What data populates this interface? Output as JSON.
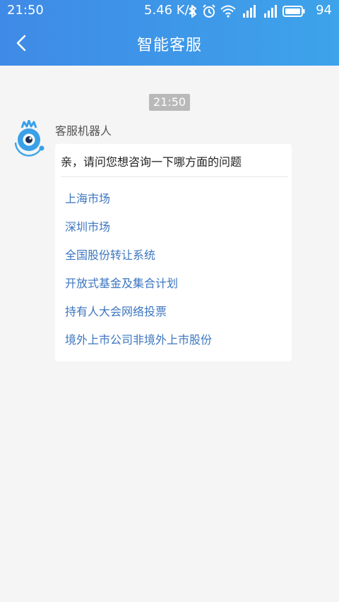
{
  "status_bar": {
    "time": "21:50",
    "network_speed": "5.46 K/s",
    "battery": "94"
  },
  "header": {
    "title": "智能客服"
  },
  "chat": {
    "timestamp": "21:50",
    "sender": "客服机器人",
    "question": "亲，请问您想咨询一下哪方面的问题",
    "options": [
      "上海市场",
      "深圳市场",
      "全国股份转让系统",
      "开放式基金及集合计划",
      "持有人大会网络投票",
      "境外上市公司非境外上市股份"
    ]
  },
  "colors": {
    "header_start": "#3f8ae6",
    "header_end": "#3da3ea",
    "option_link": "#3c76c0",
    "background": "#f5f5f5"
  }
}
